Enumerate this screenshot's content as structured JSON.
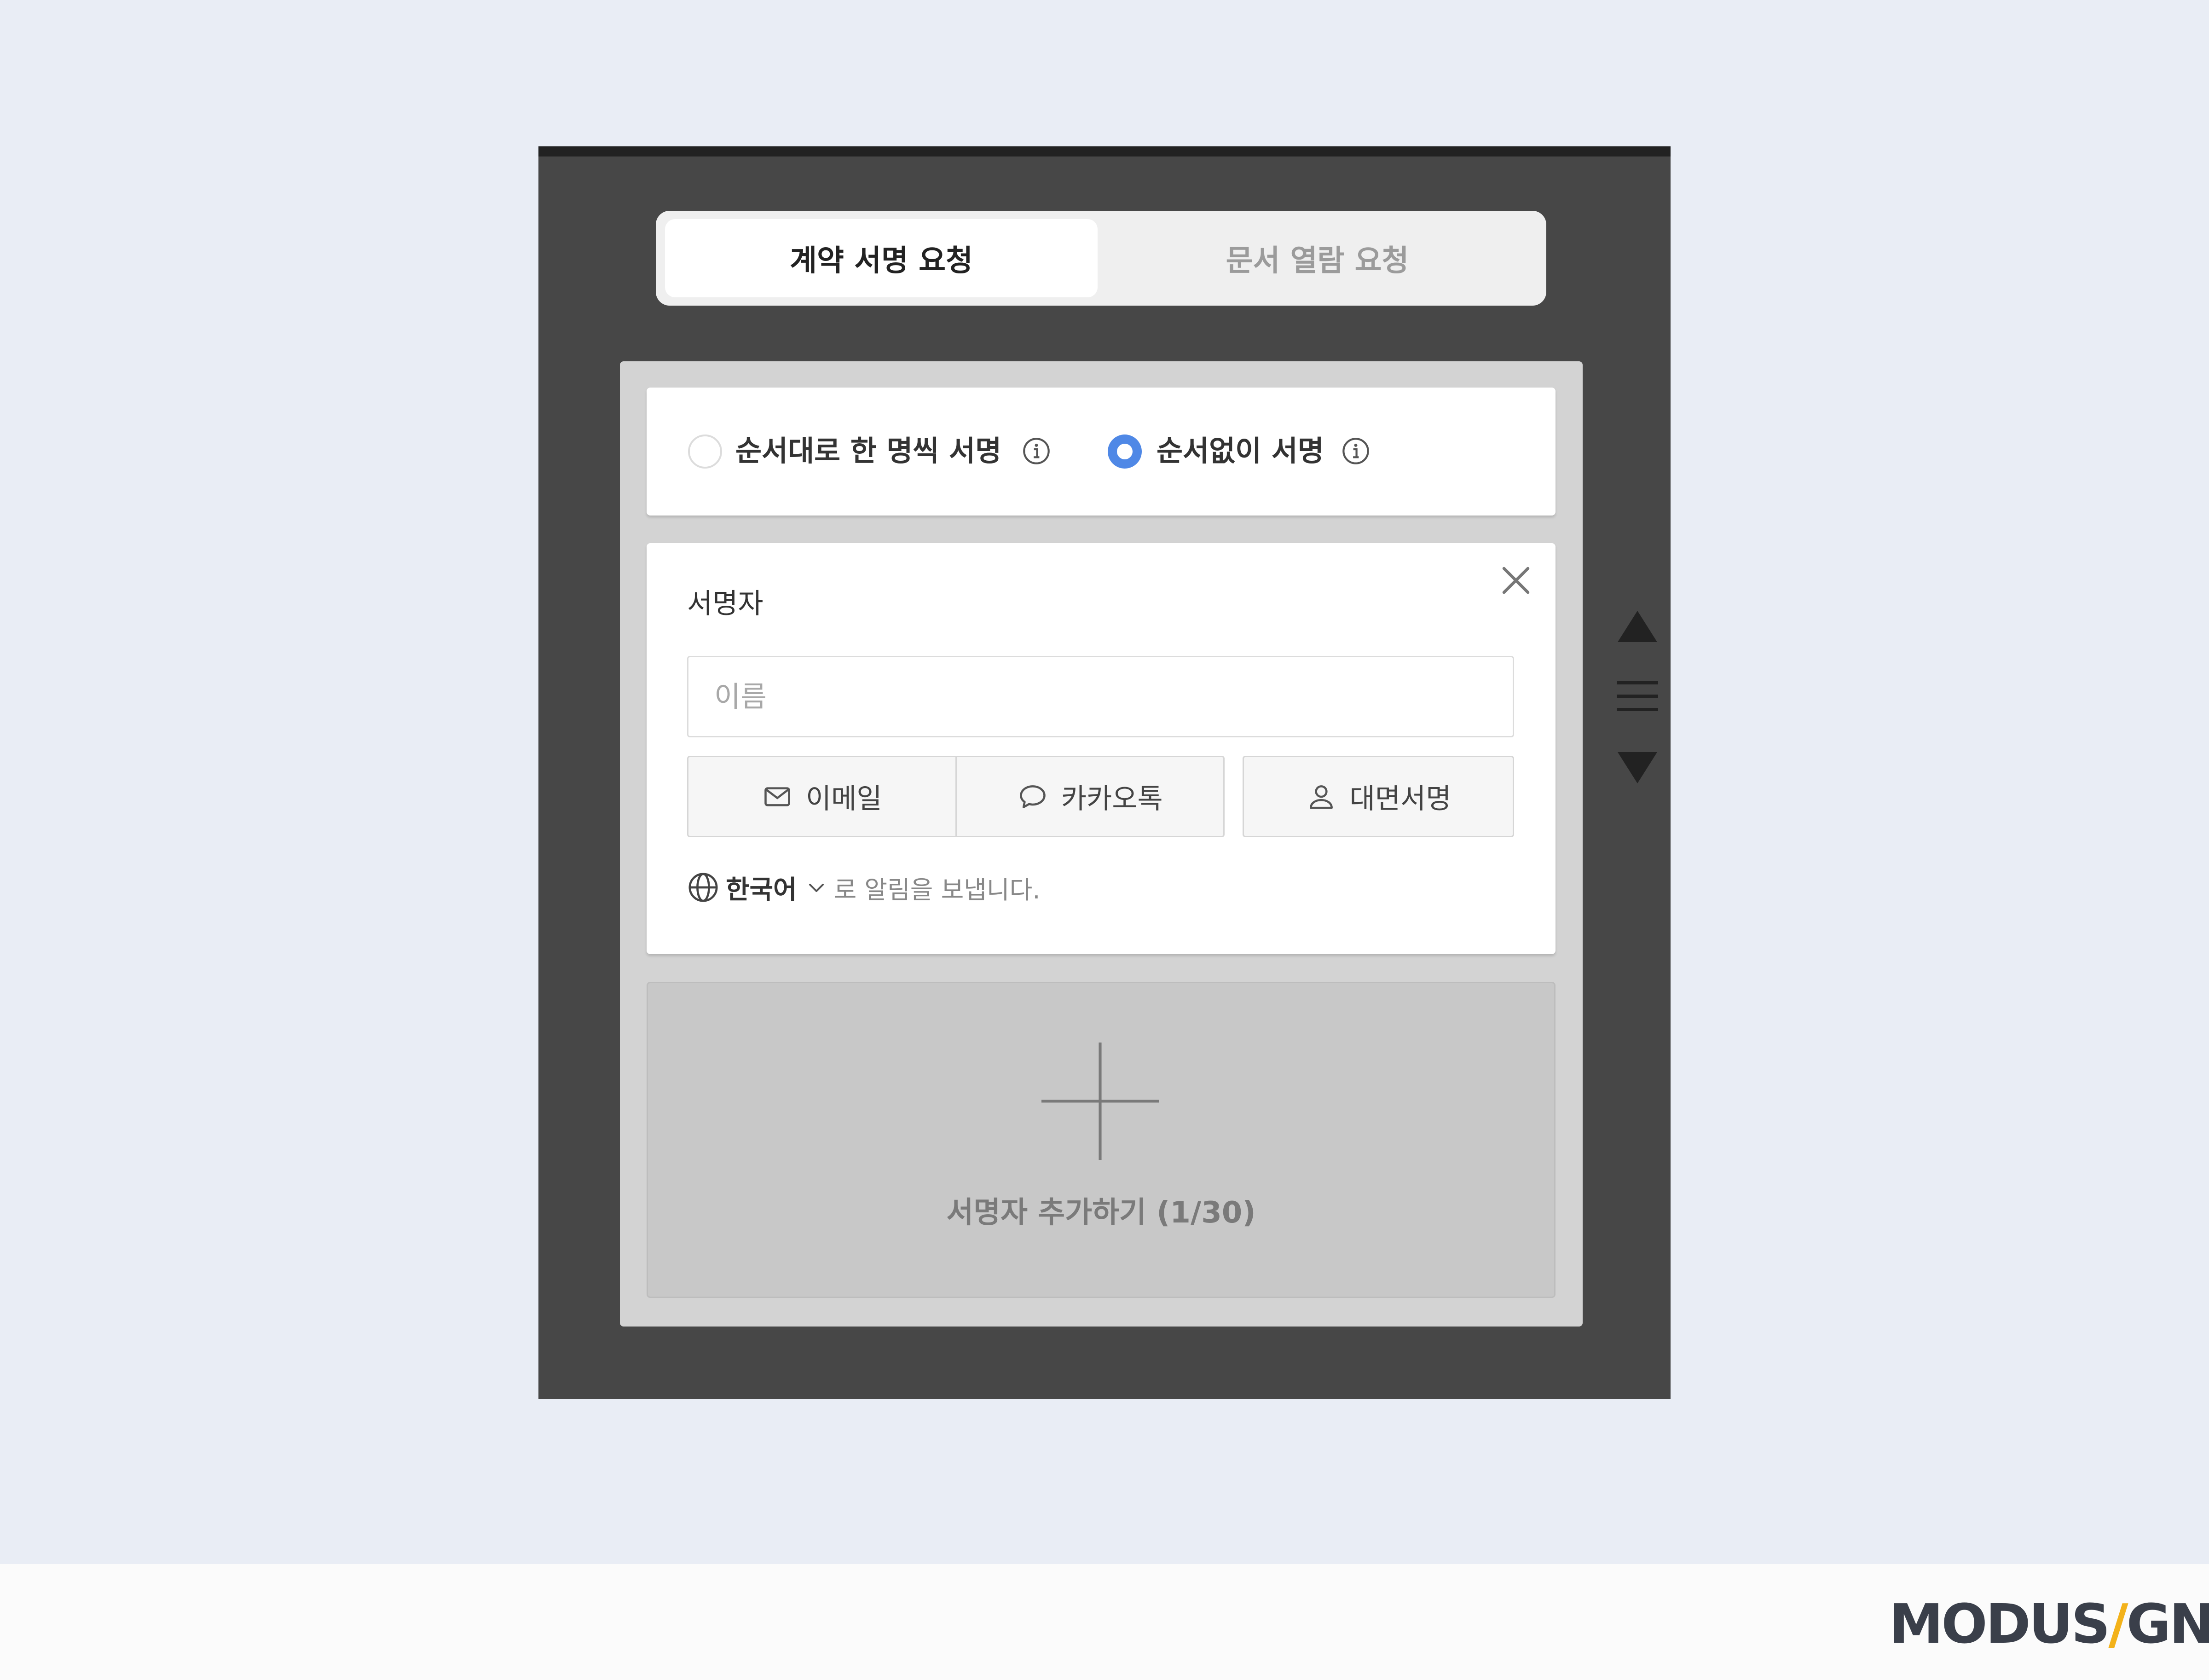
{
  "tabs": [
    {
      "label": "계약 서명 요청",
      "active": true
    },
    {
      "label": "문서 열람 요청",
      "active": false
    }
  ],
  "signing_order": {
    "options": [
      {
        "label": "순서대로 한 명씩 서명",
        "selected": false
      },
      {
        "label": "순서없이 서명",
        "selected": true
      }
    ]
  },
  "signer": {
    "title": "서명자",
    "name_placeholder": "이름",
    "methods": {
      "email": "이메일",
      "kakao": "카카오톡",
      "in_person": "대면서명"
    },
    "language": "한국어",
    "notify_text": "로 알림을 보냅니다."
  },
  "add_signer": {
    "label": "서명자 추가하기 (1/30)"
  },
  "brand": {
    "part1": "MODUS",
    "slash": "/",
    "part2": "GN"
  },
  "colors": {
    "accent": "#4f88e6",
    "brand_slash": "#f3b21a"
  }
}
